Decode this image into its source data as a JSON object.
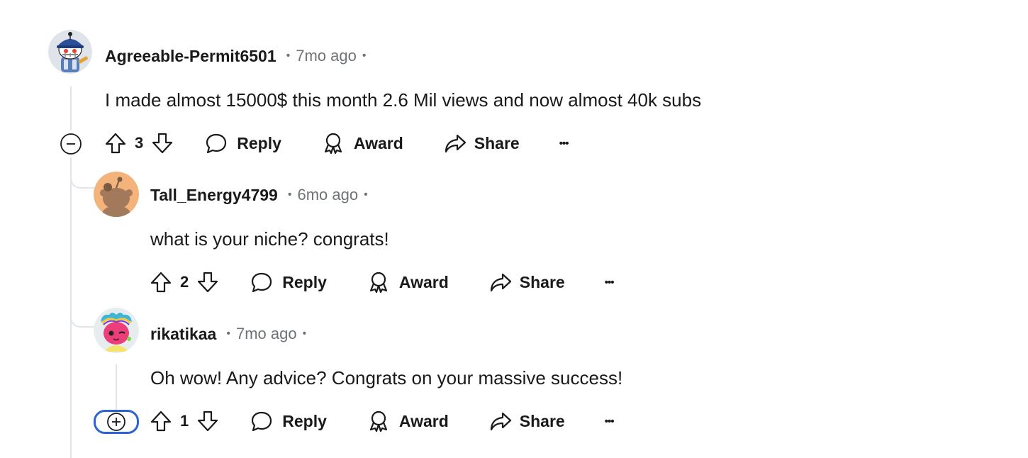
{
  "comments": [
    {
      "username": "Agreeable-Permit6501",
      "time": "7mo ago",
      "separator": "•",
      "body": "I made almost 15000$ this month 2.6 Mil views and now almost 40k subs",
      "votes": "3",
      "collapse_icon": "minus-circle-icon",
      "actions": {
        "reply": "Reply",
        "award": "Award",
        "share": "Share",
        "more": "•••"
      }
    },
    {
      "username": "Tall_Energy4799",
      "time": "6mo ago",
      "separator": "•",
      "body": "what is your niche? congrats!",
      "votes": "2",
      "actions": {
        "reply": "Reply",
        "award": "Award",
        "share": "Share",
        "more": "•••"
      }
    },
    {
      "username": "rikatikaa",
      "time": "7mo ago",
      "separator": "•",
      "body": "Oh wow! Any advice? Congrats on your massive success!",
      "votes": "1",
      "collapse_icon": "plus-circle-icon",
      "actions": {
        "reply": "Reply",
        "award": "Award",
        "share": "Share",
        "more": "•••"
      }
    }
  ],
  "colors": {
    "text": "#1a1a1b",
    "meta": "#6f7376",
    "thread_line": "#e2e5e8",
    "focus_ring": "#2d62d0",
    "avatar2_bg": "#f3b37a"
  }
}
